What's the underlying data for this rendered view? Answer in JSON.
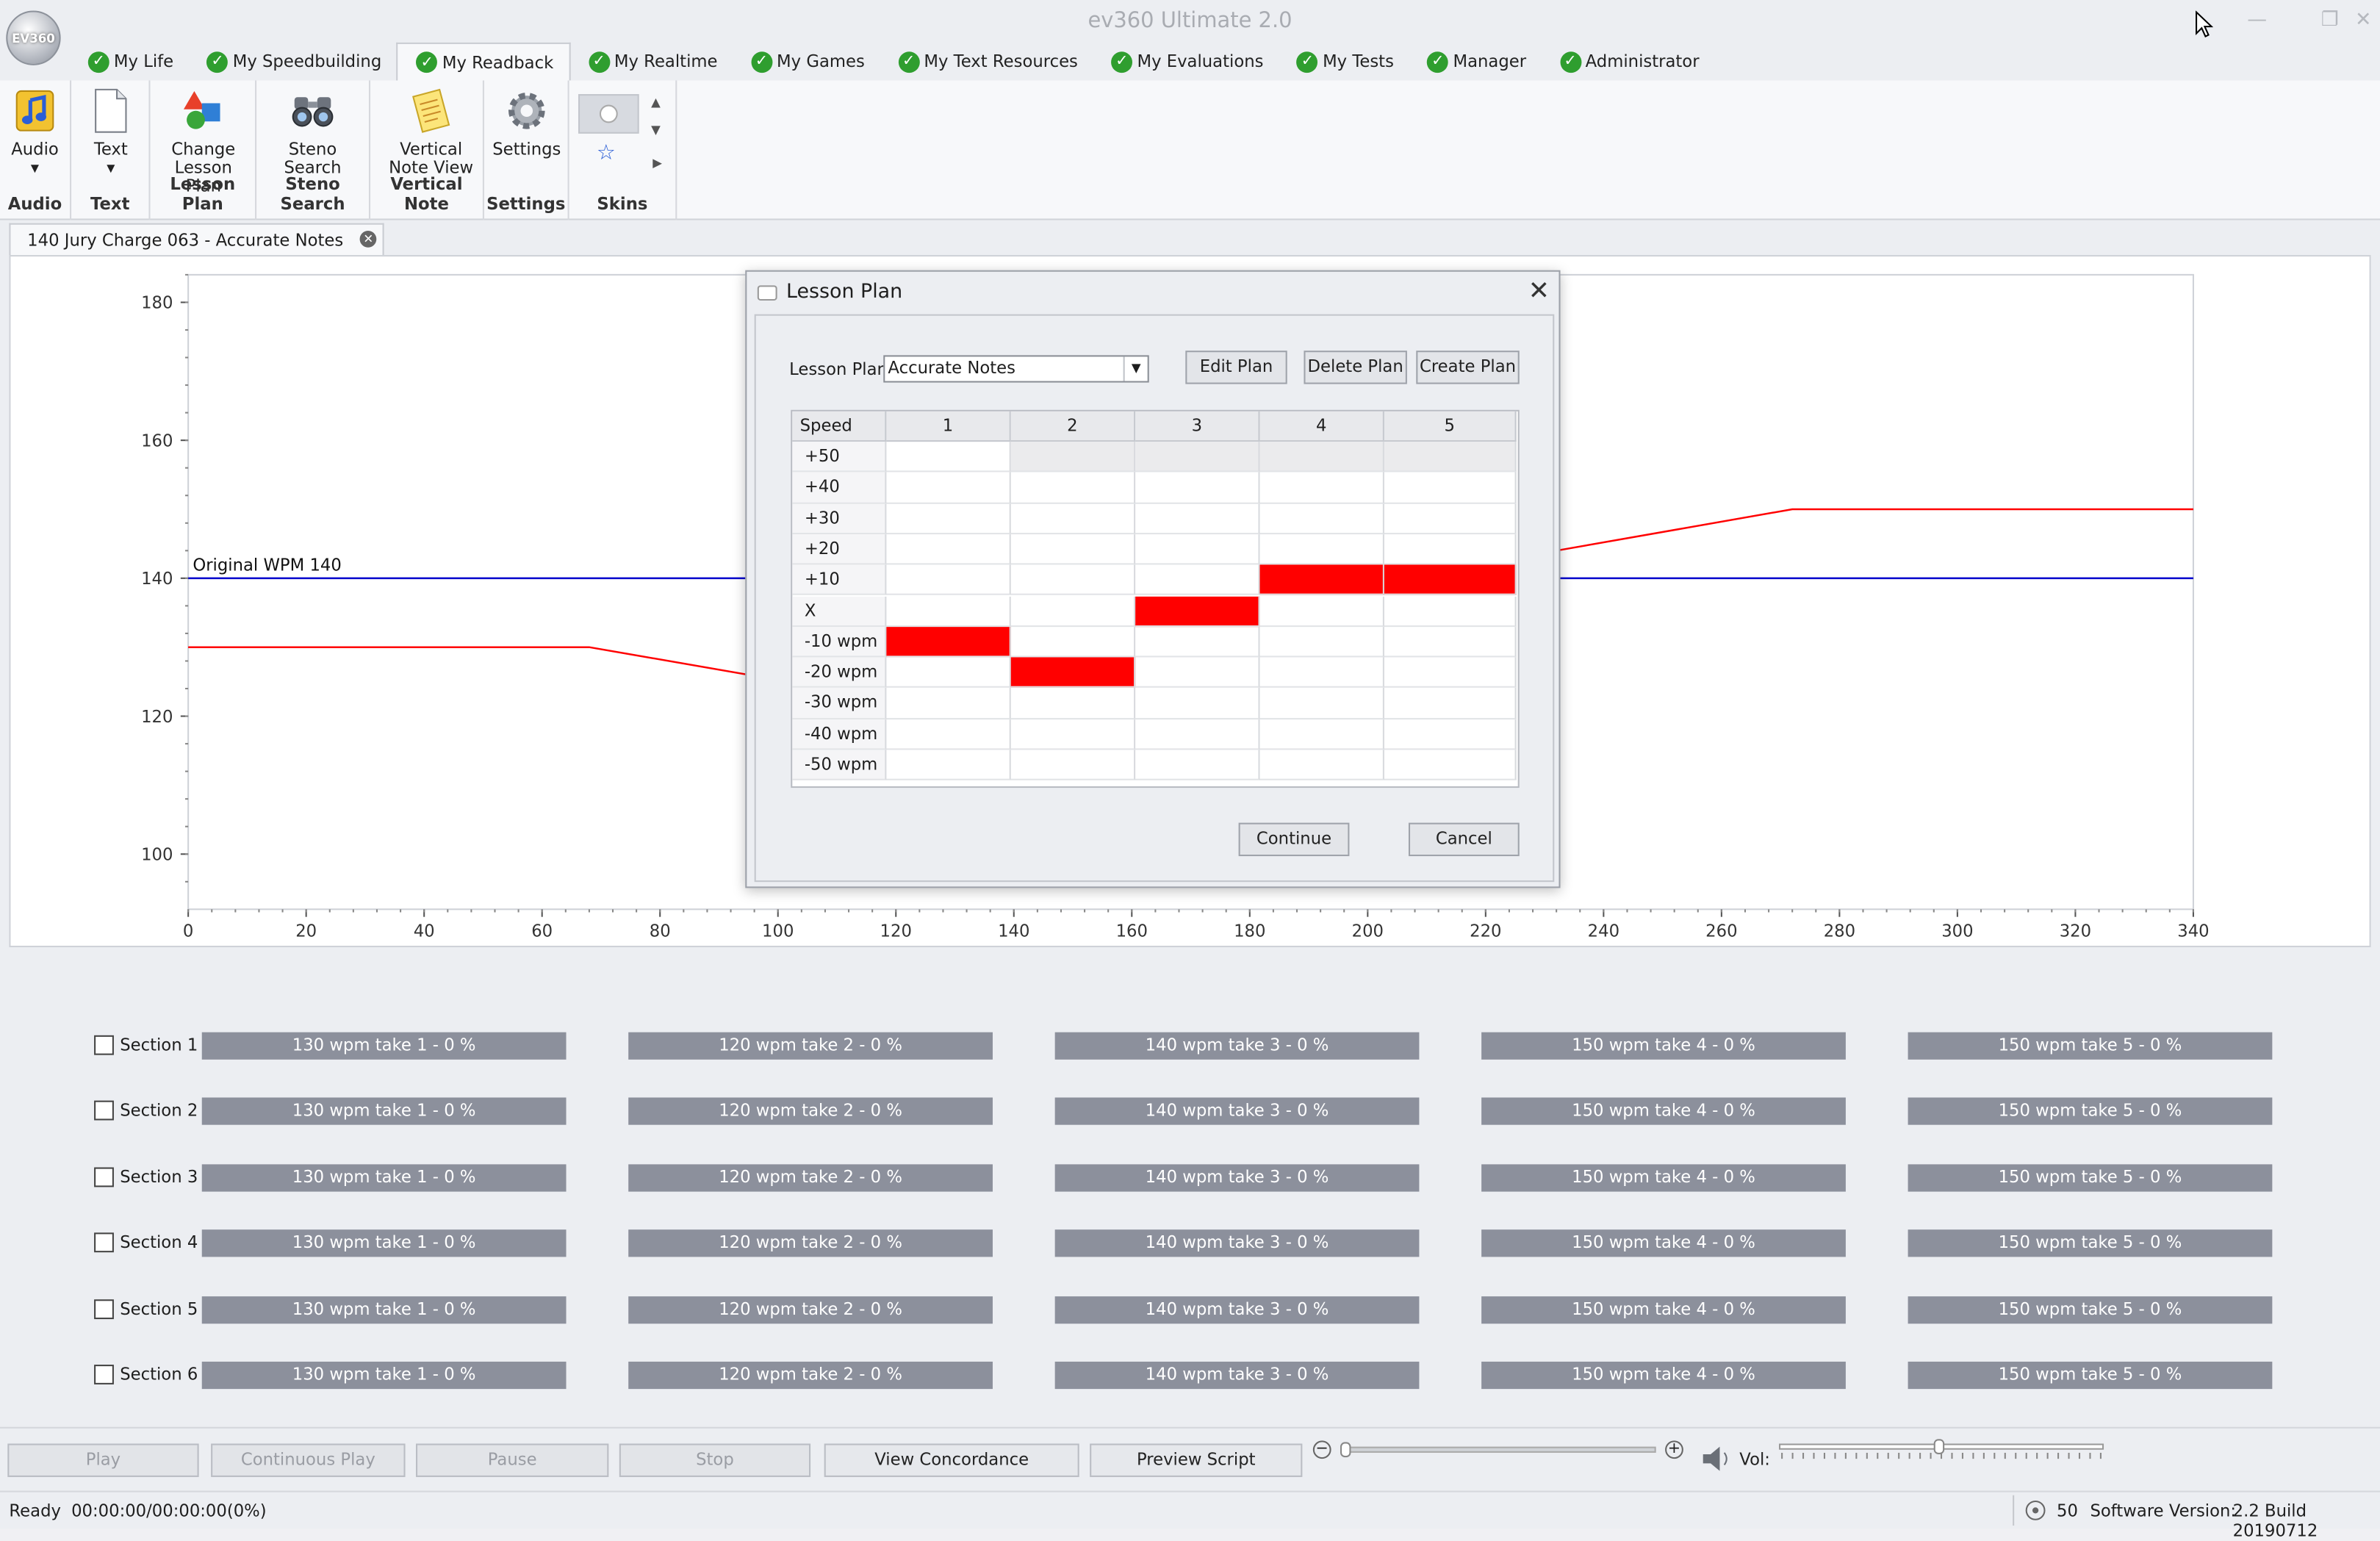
{
  "app": {
    "title": "ev360 Ultimate 2.0",
    "orb_text": "EV360"
  },
  "menu_tabs": [
    {
      "label": "My Life",
      "active": false
    },
    {
      "label": "My Speedbuilding",
      "active": false
    },
    {
      "label": "My Readback",
      "active": true
    },
    {
      "label": "My Realtime",
      "active": false
    },
    {
      "label": "My Games",
      "active": false
    },
    {
      "label": "My Text Resources",
      "active": false
    },
    {
      "label": "My Evaluations",
      "active": false
    },
    {
      "label": "My Tests",
      "active": false
    },
    {
      "label": "Manager",
      "active": false
    },
    {
      "label": "Administrator",
      "active": false
    }
  ],
  "ribbon": {
    "audio": {
      "button": "Audio",
      "group": "Audio"
    },
    "text": {
      "button": "Text",
      "group": "Text"
    },
    "lesson_plan": {
      "button_line1": "Change",
      "button_line2": "Lesson Plan",
      "group": "Lesson Plan"
    },
    "steno": {
      "button_line1": "Steno",
      "button_line2": "Search",
      "group": "Steno Search"
    },
    "vertical": {
      "button_line1": "Vertical",
      "button_line2": "Note View",
      "group": "Vertical Note"
    },
    "settings": {
      "button": "Settings",
      "group": "Settings"
    },
    "skins": {
      "group": "Skins"
    }
  },
  "document_tab": {
    "label": "140 Jury Charge 063 - Accurate Notes"
  },
  "chart_data": {
    "type": "line",
    "x_ticks": [
      0,
      20,
      40,
      60,
      80,
      100,
      120,
      140,
      160,
      180,
      200,
      220,
      240,
      260,
      280,
      300,
      320,
      340
    ],
    "y_ticks": [
      100,
      120,
      140,
      160,
      180
    ],
    "xlim": [
      0,
      340
    ],
    "ylim": [
      92,
      184
    ],
    "annotation": "Original WPM 140",
    "series": [
      {
        "color": "#0000cc",
        "x": [
          0,
          340
        ],
        "y": [
          140,
          140
        ]
      },
      {
        "color": "#ff0000",
        "x": [
          0,
          68,
          95,
          232,
          272,
          340
        ],
        "y": [
          130,
          130,
          126,
          144,
          150,
          150
        ]
      }
    ]
  },
  "dialog": {
    "title": "Lesson Plan",
    "lesson_plan_label": "Lesson Plan",
    "lesson_plan_value": "Accurate Notes",
    "edit_plan": "Edit Plan",
    "delete_plan": "Delete Plan",
    "create_plan": "Create Plan",
    "grid": {
      "speed_header": "Speed",
      "columns": [
        "1",
        "2",
        "3",
        "4",
        "5"
      ],
      "rows": [
        "+50 wpm",
        "+40 wpm",
        "+30 wpm",
        "+20 wpm",
        "+10 wpm",
        "X",
        "-10 wpm",
        "-20 wpm",
        "-30 wpm",
        "-40 wpm",
        "-50 wpm"
      ],
      "selected": [
        6,
        7,
        5,
        4,
        4
      ]
    },
    "continue": "Continue",
    "cancel": "Cancel"
  },
  "sections": [
    {
      "label": "Section 1",
      "takes": [
        "130 wpm take 1 - 0 %",
        "120 wpm take 2 - 0 %",
        "140 wpm take 3 - 0 %",
        "150 wpm take 4 - 0 %",
        "150 wpm take 5 - 0 %"
      ]
    },
    {
      "label": "Section 2",
      "takes": [
        "130 wpm take 1 - 0 %",
        "120 wpm take 2 - 0 %",
        "140 wpm take 3 - 0 %",
        "150 wpm take 4 - 0 %",
        "150 wpm take 5 - 0 %"
      ]
    },
    {
      "label": "Section 3",
      "takes": [
        "130 wpm take 1 - 0 %",
        "120 wpm take 2 - 0 %",
        "140 wpm take 3 - 0 %",
        "150 wpm take 4 - 0 %",
        "150 wpm take 5 - 0 %"
      ]
    },
    {
      "label": "Section 4",
      "takes": [
        "130 wpm take 1 - 0 %",
        "120 wpm take 2 - 0 %",
        "140 wpm take 3 - 0 %",
        "150 wpm take 4 - 0 %",
        "150 wpm take 5 - 0 %"
      ]
    },
    {
      "label": "Section 5",
      "takes": [
        "130 wpm take 1 - 0 %",
        "120 wpm take 2 - 0 %",
        "140 wpm take 3 - 0 %",
        "150 wpm take 4 - 0 %",
        "150 wpm take 5 - 0 %"
      ]
    },
    {
      "label": "Section 6",
      "takes": [
        "130 wpm take 1 - 0 %",
        "120 wpm take 2 - 0 %",
        "140 wpm take 3 - 0 %",
        "150 wpm take 4 - 0 %",
        "150 wpm take 5 - 0 %"
      ]
    }
  ],
  "controls": {
    "play": "Play",
    "continuous_play": "Continuous Play",
    "pause": "Pause",
    "stop": "Stop",
    "view_concordance": "View Concordance",
    "preview_script": "Preview  Script",
    "vol_label": "Vol:"
  },
  "status": {
    "ready": "Ready",
    "time": "00:00:00/00:00:00(0%)",
    "count": "50",
    "version_label": "Software Version:",
    "version": "2.2 Build 20190712"
  },
  "colors": {
    "accent_red": "#ff0000",
    "baseline_blue": "#0000cc",
    "take_bar": "#8c909c"
  }
}
